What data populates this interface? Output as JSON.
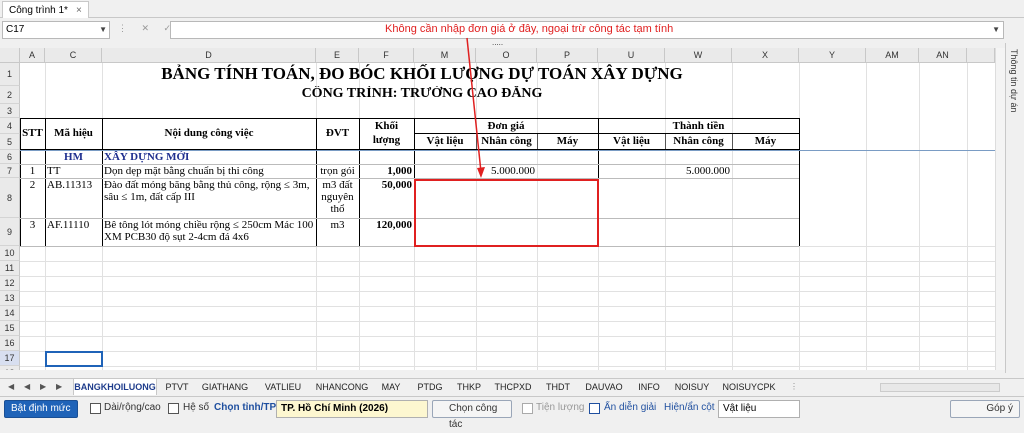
{
  "window": {
    "doc_tab": "Công trình 1*",
    "doc_tab_close": "×"
  },
  "formula_bar": {
    "cell_ref": "C17",
    "content": ""
  },
  "annotation": "Không cần nhập đơn giá ở đây, ngoại trừ công tác tạm tính",
  "columns": [
    "A",
    "C",
    "D",
    "E",
    "F",
    "M",
    "O",
    "P",
    "U",
    "W",
    "X",
    "Y",
    "AM",
    "AN"
  ],
  "rows": [
    "1",
    "2",
    "3",
    "4",
    "5",
    "6",
    "7",
    "8",
    "9",
    "10",
    "11",
    "12",
    "13",
    "14",
    "15",
    "16",
    "17",
    "18"
  ],
  "sheet": {
    "title": "BẢNG TÍNH TOÁN, ĐO BÓC KHỐI LƯỢNG DỰ TOÁN XÂY DỰNG",
    "subtitle": "CÔNG TRÌNH: TRƯỜNG CAO ĐẲNG",
    "headers": {
      "stt": "STT",
      "ma_hieu": "Mã hiệu",
      "noi_dung": "Nội dung công việc",
      "dvt": "ĐVT",
      "khoi_luong_1": "Khối",
      "khoi_luong_2": "lượng",
      "don_gia": "Đơn giá",
      "thanh_tien": "Thành tiền",
      "vat_lieu": "Vật liệu",
      "nhan_cong": "Nhân công",
      "may": "Máy"
    },
    "group": {
      "code": "HM",
      "name": "XÂY DỰNG MỚI"
    },
    "items": [
      {
        "stt": "1",
        "code": "TT",
        "desc": [
          "Dọn dẹp mặt bằng chuẩn bị thi công"
        ],
        "unit": [
          "trọn gói"
        ],
        "qty": "1,000",
        "nhan_cong": "5.000.000",
        "tt_nhan_cong": "5.000.000"
      },
      {
        "stt": "2",
        "code": "AB.11313",
        "desc": [
          "Đào đất móng băng bằng thủ công, rộng ≤ 3m,",
          "sâu ≤ 1m, đất cấp III"
        ],
        "unit": [
          "m3 đất",
          "nguyên",
          "thổ"
        ],
        "qty": "50,000",
        "nhan_cong": "",
        "tt_nhan_cong": ""
      },
      {
        "stt": "3",
        "code": "AF.11110",
        "desc": [
          "Bê tông lót móng chiều rộng ≤ 250cm Mác 100",
          "XM PCB30 độ sụt 2-4cm đá 4x6"
        ],
        "unit": [
          "m3"
        ],
        "qty": "120,000",
        "nhan_cong": "",
        "tt_nhan_cong": ""
      }
    ]
  },
  "right_panel": "Thông tin dự án",
  "sheet_tabs": [
    "BANGKHOILUONG",
    "PTVT",
    "GIATHANG",
    "VATLIEU",
    "NHANCONG",
    "MAY",
    "PTDG",
    "THKP",
    "THCPXD",
    "THDT",
    "DAUVAO",
    "INFO",
    "NOISUY",
    "NOISUYCPK"
  ],
  "bottom": {
    "bat_dinh_muc": "Bật định mức",
    "dai_rong_cao": "Dài/rộng/cao",
    "he_so": "Hệ số",
    "chon_tinh_label": "Chọn tỉnh/TP:",
    "chon_tinh_value": "TP. Hồ Chí Minh (2026)",
    "chon_cong_tac": "Chọn công tác",
    "tien_luong": "Tiện lượng",
    "an_dien_giai": "Ẩn diễn giải",
    "hien_an_cot": "Hiện/ẩn cột",
    "hien_an_cot_value": "Vật liệu",
    "gop_y": "Góp ý"
  },
  "colors": {
    "annotation": "#e02020",
    "selection": "#1f63b8",
    "tab_active": "#1f3d8c"
  }
}
